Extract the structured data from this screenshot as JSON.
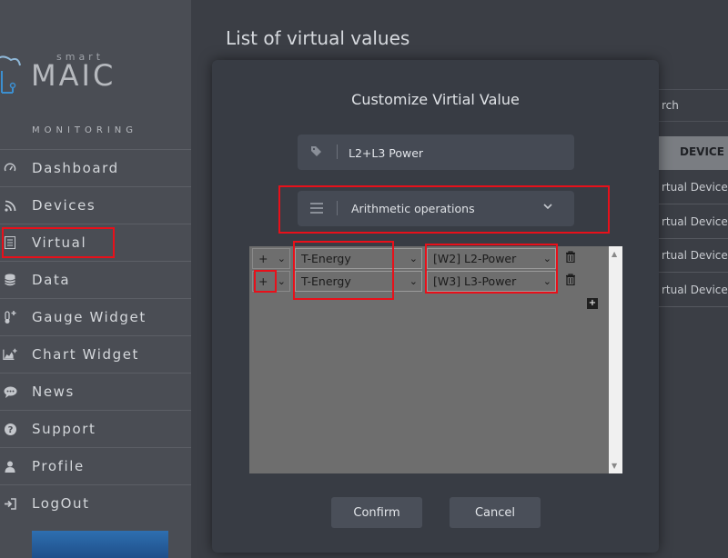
{
  "sidebar": {
    "logo_small": "smart",
    "logo_big": "MAIC",
    "tagline": "MONITORING",
    "items": [
      {
        "label": "Dashboard",
        "icon": "speedometer-icon"
      },
      {
        "label": "Devices",
        "icon": "rss-icon"
      },
      {
        "label": "Virtual",
        "icon": "list-icon"
      },
      {
        "label": "Data",
        "icon": "database-icon"
      },
      {
        "label": "Gauge Widget",
        "icon": "thermometer-plus-icon"
      },
      {
        "label": "Chart Widget",
        "icon": "area-chart-plus-icon"
      },
      {
        "label": "News",
        "icon": "comment-icon"
      },
      {
        "label": "Support",
        "icon": "question-icon"
      },
      {
        "label": "Profile",
        "icon": "user-icon"
      },
      {
        "label": "LogOut",
        "icon": "logout-icon"
      }
    ]
  },
  "page": {
    "title": "List of virtual values",
    "search_fragment": "rch",
    "device_header": "DEVICE",
    "rows": [
      "rtual Device",
      "rtual Device",
      "rtual Device",
      "rtual Device"
    ]
  },
  "modal": {
    "title": "Customize Virtial Value",
    "name_value": "L2+L3 Power",
    "ops_label": "Arithmetic operations",
    "operations": [
      {
        "operator": "+",
        "type": "T-Energy",
        "value": "[W2] L2-Power"
      },
      {
        "operator": "+",
        "type": "T-Energy",
        "value": "[W3] L3-Power"
      }
    ],
    "add_label": "+",
    "confirm": "Confirm",
    "cancel": "Cancel"
  },
  "colors": {
    "highlight": "#e8101a",
    "sidebar_bg": "#4a4d54",
    "modal_bg": "#383c44"
  }
}
